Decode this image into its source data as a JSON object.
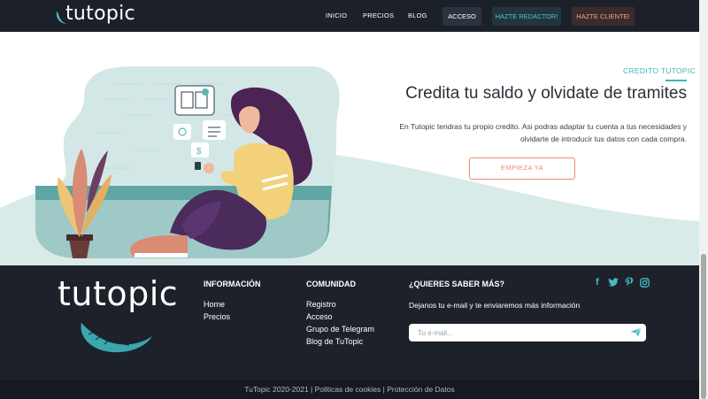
{
  "brand": {
    "name": "tutopic"
  },
  "nav": {
    "links": [
      "INICIO",
      "PRECIOS",
      "BLOG"
    ],
    "acceso": "ACCESO",
    "redactor": "HAZTE REDACTOR!",
    "cliente": "HAZTE CLIENTE!"
  },
  "hero": {
    "eyebrow": "CREDITO TUTOPIC",
    "title": "Credita tu saldo y olvidate de tramites",
    "text_line1": "En Tutopic tendras tu propio credito. Asi podras adaptar tu cuenta a tus necesidades y",
    "text_line2": "olvidarte de introducir tus datos con cada compra.",
    "cta": "EMPIEZA YA"
  },
  "footer": {
    "logo_text": "tutopic",
    "info": {
      "title": "INFORMACIÓN",
      "links": [
        "Home",
        "Precios"
      ]
    },
    "community": {
      "title": "COMUNIDAD",
      "links": [
        "Registro",
        "Acceso",
        "Grupo de Telegram",
        "Blog de TuTopic"
      ]
    },
    "newsletter": {
      "title": "¿QUIERES SABER MÁS?",
      "text": "Dejanos tu e-mail y te enviaremos más información",
      "placeholder": "Tu e-mail..."
    },
    "social": [
      "f",
      "twitter",
      "pinterest",
      "instagram"
    ],
    "copyright": "TuTopic 2020-2021 | Politicas de cookies | Protección de Datos"
  },
  "colors": {
    "header_bg": "#1c2129",
    "accent_teal": "#3ab7be",
    "accent_coral": "#ec8b72",
    "footer_bg": "#1d222a"
  }
}
